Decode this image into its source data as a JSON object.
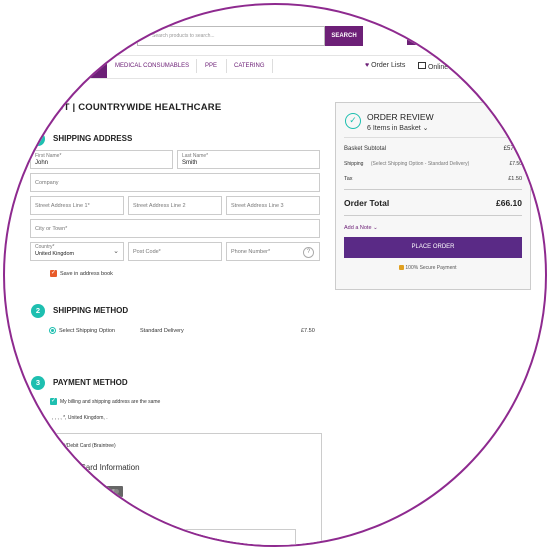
{
  "search": {
    "placeholder": "Search products to search...",
    "button_label": "SEARCH"
  },
  "nav": {
    "items": [
      "MEDICAL CONSUMABLES",
      "PPE",
      "CATERING"
    ],
    "order_lists": "Order Lists",
    "online": "Online"
  },
  "checkout": {
    "title": "OUT | COUNTRYWIDE HEALTHCARE"
  },
  "shipping_address": {
    "step": "1",
    "title": "SHIPPING ADDRESS",
    "first_name_label": "First Name*",
    "first_name_value": "John",
    "last_name_label": "Last Name*",
    "last_name_value": "Smith",
    "company_placeholder": "Company",
    "street1_placeholder": "Street Address Line 1*",
    "street2_placeholder": "Street Address Line 2",
    "street3_placeholder": "Street Address Line 3",
    "city_placeholder": "City or Town*",
    "country_label": "Country*",
    "country_value": "United Kingdom",
    "postcode_placeholder": "Post Code*",
    "phone_placeholder": "Phone Number*",
    "help_icon": "?",
    "save_label": "Save in address book"
  },
  "shipping_method": {
    "step": "2",
    "title": "SHIPPING METHOD",
    "option_label": "Select Shipping Option",
    "option_name": "Standard Delivery",
    "option_price": "£7.50"
  },
  "payment_method": {
    "step": "3",
    "title": "PAYMENT METHOD",
    "same_address_label": "My billing and shipping address are the same",
    "address_line": ", , , , *, United Kingdom, .",
    "card_method_label": "Credit/Debit Card (Braintree)",
    "card_info_title": "Card Information"
  },
  "order_review": {
    "title": "ORDER REVIEW",
    "items": "6 Items in Basket",
    "subtotal_label": "Basket Subtotal",
    "subtotal_value": "£57.10",
    "shipping_label": "Shipping",
    "shipping_note": "(Select Shipping Option - Standard Delivery)",
    "shipping_value": "£7.50",
    "tax_label": "Tax",
    "tax_value": "£1.50",
    "total_label": "Order Total",
    "total_value": "£66.10",
    "add_note": "Add a Note",
    "place_order": "PLACE ORDER",
    "secure": "100% Secure Payment"
  },
  "colors": {
    "brand_purple": "#6d2077",
    "teal": "#1ebfb0",
    "orange": "#e85b2a",
    "border": "#8e2a8f"
  }
}
